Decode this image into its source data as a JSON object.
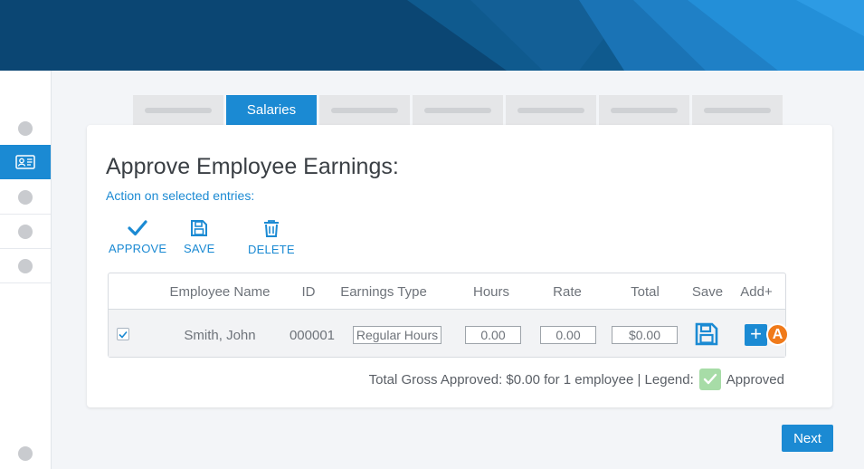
{
  "tabs": [
    {
      "label": ""
    },
    {
      "label": "Salaries"
    },
    {
      "label": ""
    },
    {
      "label": ""
    },
    {
      "label": ""
    },
    {
      "label": ""
    },
    {
      "label": ""
    }
  ],
  "page": {
    "title": "Approve Employee Earnings:",
    "subtitle": "Action on selected entries:"
  },
  "actions": {
    "approve": "APPROVE",
    "save": "SAVE",
    "delete": "DELETE"
  },
  "table": {
    "headers": {
      "employee_name": "Employee Name",
      "id": "ID",
      "earnings_type": "Earnings Type",
      "hours": "Hours",
      "rate": "Rate",
      "total": "Total",
      "save": "Save",
      "add": "Add+"
    },
    "rows": [
      {
        "selected": true,
        "employee_name": "Smith, John",
        "id": "000001",
        "earnings_type": "Regular Hours",
        "hours": "0.00",
        "rate": "0.00",
        "total": "$0.00"
      }
    ],
    "add_button": "+",
    "marker": "A"
  },
  "footer": {
    "summary": "Total Gross Approved: $0.00 for 1 employee | Legend:",
    "legend_label": "Approved"
  },
  "next_button": "Next",
  "colors": {
    "accent": "#1b8ad3",
    "banner": "#0b4673",
    "approved_legend": "#a7dca7",
    "marker": "#f07a1a"
  }
}
